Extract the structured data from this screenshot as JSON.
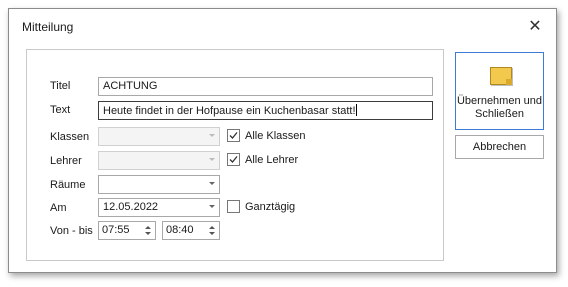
{
  "window": {
    "title": "Mitteilung",
    "close_glyph": "✕"
  },
  "form": {
    "titel": {
      "label": "Titel",
      "value": "ACHTUNG"
    },
    "text": {
      "label": "Text",
      "value": "Heute findet in der Hofpause ein Kuchenbasar statt!"
    },
    "klassen": {
      "label": "Klassen",
      "value": "",
      "checkbox_label": "Alle Klassen",
      "checked": true
    },
    "lehrer": {
      "label": "Lehrer",
      "value": "",
      "checkbox_label": "Alle Lehrer",
      "checked": true
    },
    "raeume": {
      "label": "Räume",
      "value": ""
    },
    "am": {
      "label": "Am",
      "value": "12.05.2022",
      "checkbox_label": "Ganztägig",
      "checked": false
    },
    "von_bis": {
      "label": "Von - bis",
      "from": "07:55",
      "to": "08:40"
    }
  },
  "buttons": {
    "apply_line1": "Übernehmen und",
    "apply_line2": "Schließen",
    "apply_icon": "note-icon",
    "cancel": "Abbrechen"
  },
  "colors": {
    "accent_border": "#3d7bd6",
    "note_yellow": "#f2c94c"
  }
}
